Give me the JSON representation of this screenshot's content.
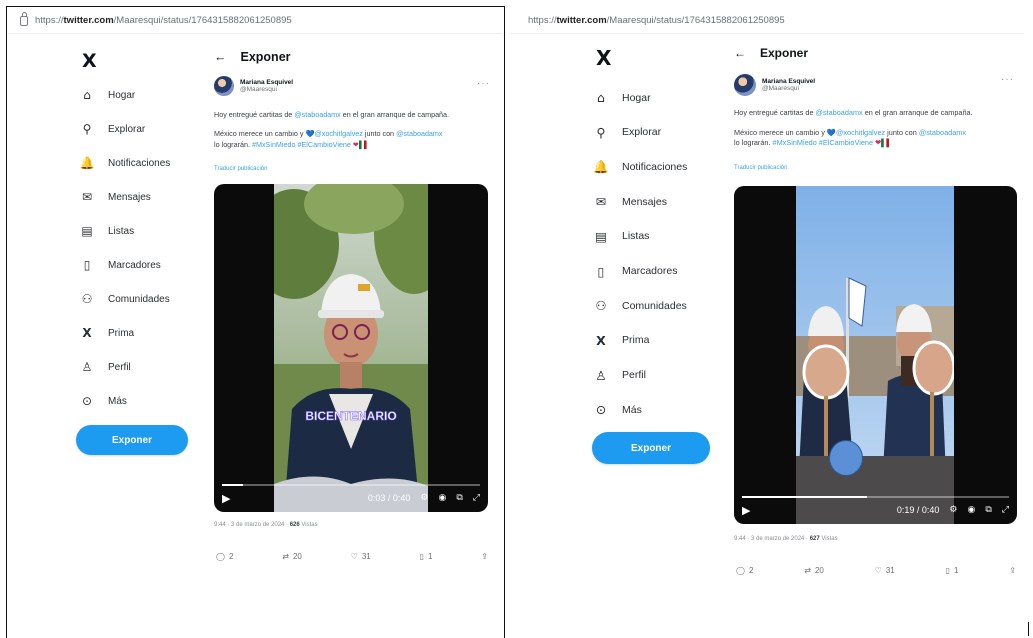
{
  "left": {
    "url_prefix": "https://",
    "url_domain": "twitter.com",
    "url_path": "/Maaresqui/status/1764315882061250895",
    "logo": "X",
    "nav": [
      {
        "icon": "home-icon",
        "glyph": "⌂",
        "label": "Hogar"
      },
      {
        "icon": "search-icon",
        "glyph": "⚲",
        "label": "Explorar"
      },
      {
        "icon": "bell-icon",
        "glyph": "🔔",
        "label": "Notificaciones"
      },
      {
        "icon": "envelope-icon",
        "glyph": "✉",
        "label": "Mensajes"
      },
      {
        "icon": "list-icon",
        "glyph": "▤",
        "label": "Listas"
      },
      {
        "icon": "bookmark-icon",
        "glyph": "▯",
        "label": "Marcadores"
      },
      {
        "icon": "communities-icon",
        "glyph": "⚇",
        "label": "Comunidades"
      },
      {
        "icon": "x-premium-icon",
        "glyph": "X",
        "label": "Prima"
      },
      {
        "icon": "profile-icon",
        "glyph": "♙",
        "label": "Perfil"
      },
      {
        "icon": "more-circle-icon",
        "glyph": "⊙",
        "label": "Más"
      }
    ],
    "post_button": "Exponer",
    "header_title": "Exponer",
    "author_name": "Mariana Esquivel",
    "author_handle": "@Maaresqui",
    "text_line1_a": "Hoy entregué cartitas de ",
    "text_line1_mention": "@staboadamx",
    "text_line1_b": " en el gran arranque de campaña.",
    "text_line2_a": "México merece un cambio y ",
    "text_line2_mention": "@xochitlgalvez",
    "text_line2_b": " junto con ",
    "text_line2_mention2": "@staboadamx",
    "text_line3_a": "lo lograrán. ",
    "text_line3_tags": "#MxSinMiedo #ElCambioViene",
    "translate": "Traducir publicación",
    "video_overlay_text": "BICENTENARIO",
    "video_time": "0:03 / 0:40",
    "progress": 0.08,
    "meta_time": "9:44 · 3 de marzo de 2024 · ",
    "meta_views": "626",
    "meta_views_label": " Vistas",
    "replies": "2",
    "reposts": "20",
    "likes": "31",
    "bookmarks": "1"
  },
  "right": {
    "url_prefix": "https://",
    "url_domain": "twitter.com",
    "url_path": "/Maaresqui/status/1764315882061250895",
    "logo": "X",
    "nav": [
      {
        "icon": "home-icon",
        "glyph": "⌂",
        "label": "Hogar"
      },
      {
        "icon": "search-icon",
        "glyph": "⚲",
        "label": "Explorar"
      },
      {
        "icon": "bell-icon",
        "glyph": "🔔",
        "label": "Notificaciones"
      },
      {
        "icon": "envelope-icon",
        "glyph": "✉",
        "label": "Mensajes"
      },
      {
        "icon": "list-icon",
        "glyph": "▤",
        "label": "Listas"
      },
      {
        "icon": "bookmark-icon",
        "glyph": "▯",
        "label": "Marcadores"
      },
      {
        "icon": "communities-icon",
        "glyph": "⚇",
        "label": "Comunidades"
      },
      {
        "icon": "x-premium-icon",
        "glyph": "X",
        "label": "Prima"
      },
      {
        "icon": "profile-icon",
        "glyph": "♙",
        "label": "Perfil"
      },
      {
        "icon": "more-circle-icon",
        "glyph": "⊙",
        "label": "Más"
      }
    ],
    "post_button": "Exponer",
    "header_title": "Exponer",
    "author_name": "Mariana Esquivel",
    "author_handle": "@Maaresqui",
    "text_line1_a": "Hoy entregué cartitas de ",
    "text_line1_mention": "@staboadamx",
    "text_line1_b": " en el gran arranque de campaña.",
    "text_line2_a": "México merece un cambio y ",
    "text_line2_mention": "@xochitlgalvez",
    "text_line2_b": " junto con ",
    "text_line2_mention2": "@staboadamx",
    "text_line3_a": "lo lograrán. ",
    "text_line3_tags": "#MxSinMiedo #ElCambioViene",
    "translate": "Traducir publicación",
    "video_time": "0:19 / 0:40",
    "progress": 0.47,
    "meta_time": "9:44 · 3 de marzo de 2024 · ",
    "meta_views": "627",
    "meta_views_label": " Vistas",
    "replies": "2",
    "reposts": "20",
    "likes": "31",
    "bookmarks": "1"
  },
  "colors": {
    "accent": "#1d9bf0",
    "link": "#3ba3e8",
    "border": "#111111"
  }
}
